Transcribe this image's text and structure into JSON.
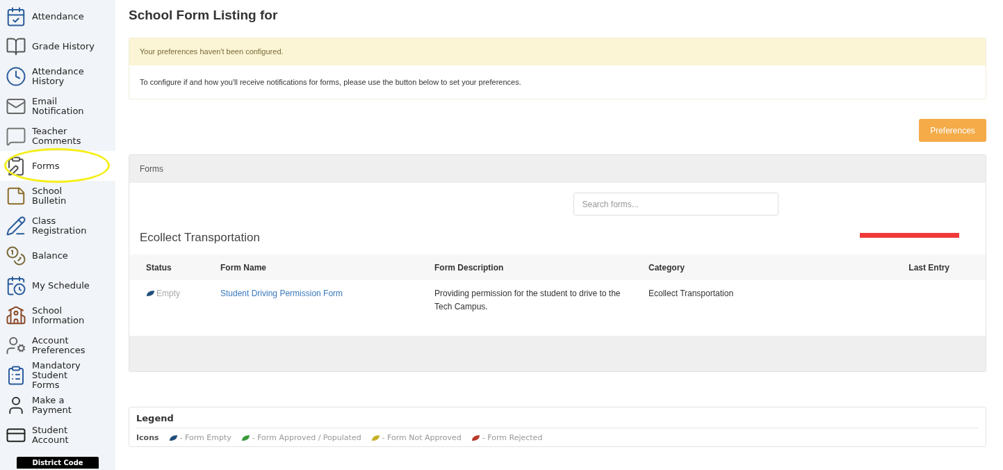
{
  "sidebar": {
    "items": [
      {
        "label": "Attendance",
        "selected": false
      },
      {
        "label": "Grade History",
        "selected": false
      },
      {
        "label": "Attendance History",
        "selected": false
      },
      {
        "label": "Email Notification",
        "selected": false
      },
      {
        "label": "Teacher Comments",
        "selected": false
      },
      {
        "label": "Forms",
        "selected": true
      },
      {
        "label": "School Bulletin",
        "selected": false
      },
      {
        "label": "Class Registration",
        "selected": false
      },
      {
        "label": "Balance",
        "selected": false
      },
      {
        "label": "My Schedule",
        "selected": false
      },
      {
        "label": "School Information",
        "selected": false
      },
      {
        "label": "Account Preferences",
        "selected": false
      },
      {
        "label": "Mandatory Student Forms",
        "selected": false
      },
      {
        "label": "Make a Payment",
        "selected": false
      },
      {
        "label": "Student Account",
        "selected": false
      }
    ],
    "district_button": "District Code"
  },
  "page_title": "School Form Listing for",
  "alert": {
    "heading": "Your preferences haven't been configured.",
    "message": "To configure if and how you'll receive notifications for forms, please use the button below to set your preferences."
  },
  "preferences_button": "Preferences",
  "forms_panel": {
    "title": "Forms",
    "search": {
      "placeholder": "Search forms..."
    },
    "group_title": "Ecollect Transportation",
    "table": {
      "columns": [
        "Status",
        "Form Name",
        "Form Description",
        "Category",
        "Last Entry"
      ],
      "rows": [
        {
          "status": "Empty",
          "color": "#1f4e79",
          "form_name": "Student Driving Permission Form",
          "description": "Providing permission for the student to drive to the Tech Campus.",
          "category": "Ecollect Transportation"
        }
      ]
    }
  },
  "legend": {
    "title": "Legend",
    "label": "Icons",
    "items": [
      {
        "text": "- Form Empty",
        "color": "#1f4e79"
      },
      {
        "text": "- Form Approved / Populated",
        "color": "#3a9a3a"
      },
      {
        "text": "- Form Not Approved",
        "color": "#c8b02a"
      },
      {
        "text": "- Form Rejected",
        "color": "#b83a2a"
      }
    ]
  }
}
